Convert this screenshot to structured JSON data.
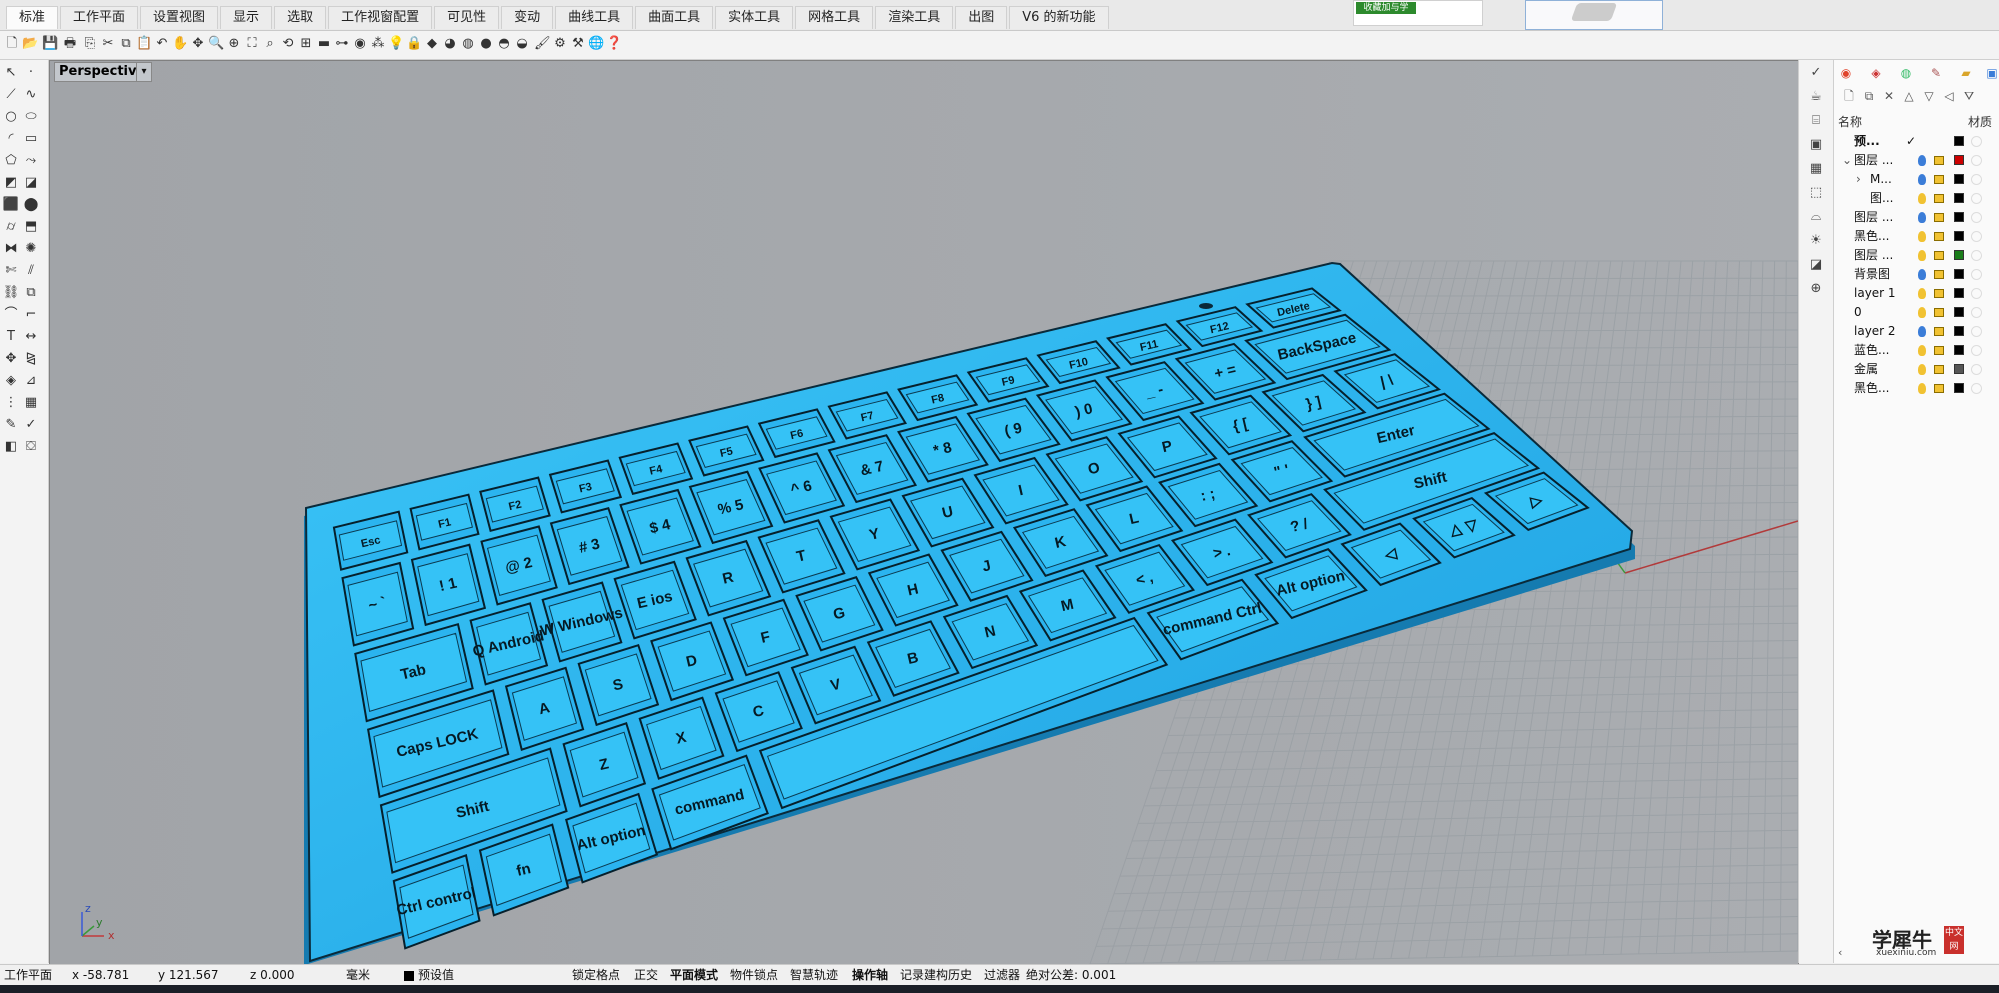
{
  "tabs": [
    {
      "label": "标准",
      "active": true
    },
    {
      "label": "工作平面"
    },
    {
      "label": "设置视图"
    },
    {
      "label": "显示"
    },
    {
      "label": "选取"
    },
    {
      "label": "工作视窗配置"
    },
    {
      "label": "可见性"
    },
    {
      "label": "变动"
    },
    {
      "label": "曲线工具"
    },
    {
      "label": "曲面工具"
    },
    {
      "label": "实体工具"
    },
    {
      "label": "网格工具"
    },
    {
      "label": "渲染工具"
    },
    {
      "label": "出图"
    },
    {
      "label": "V6 的新功能"
    }
  ],
  "ad_banner_text": "收藏加与学",
  "viewport": {
    "label": "Perspective",
    "menu_arrow": "▾",
    "axis_x": "x",
    "axis_y": "y",
    "axis_z": "z"
  },
  "keyboard": {
    "color": "#29b6f0",
    "rows": [
      {
        "keys": [
          "Esc",
          "F1",
          "F2",
          "F3",
          "F4",
          "F5",
          "F6",
          "F7",
          "F8",
          "F9",
          "F10",
          "F11",
          "F12",
          "Delete"
        ]
      },
      {
        "keys": [
          "~ `",
          "! 1",
          "@ 2",
          "# 3",
          "$ 4",
          "% 5",
          "^ 6",
          "& 7",
          "* 8",
          "( 9",
          ") 0",
          "_ -",
          "+ =",
          "BackSpace"
        ]
      },
      {
        "keys": [
          "Tab",
          "Q Android",
          "W Windows",
          "E ios",
          "R",
          "T",
          "Y",
          "U",
          "I",
          "O",
          "P",
          "{ [",
          "} ]",
          "| \\"
        ]
      },
      {
        "keys": [
          "Caps LOCK",
          "A",
          "S",
          "D",
          "F",
          "G",
          "H",
          "J",
          "K",
          "L",
          ": ;",
          "\" '",
          "Enter"
        ]
      },
      {
        "keys": [
          "Shift",
          "Z",
          "X",
          "C",
          "V",
          "B",
          "N",
          "M",
          "< ,",
          "> .",
          "? /",
          "Shift"
        ]
      },
      {
        "keys": [
          "Ctrl control",
          "fn",
          "Alt option",
          "command",
          "",
          "command Ctrl",
          "Alt option",
          "◁",
          "△ ▽",
          "▷"
        ]
      }
    ]
  },
  "layer_panel": {
    "tabs": [
      "color-icon",
      "layer-icon",
      "material-icon",
      "paint-icon",
      "folder-icon",
      "display-icon"
    ],
    "col_name": "名称",
    "col_material": "材质",
    "layers": [
      {
        "name": "预...",
        "indent": 0,
        "bold": true,
        "check": "✓",
        "color": "#000000",
        "expander": ""
      },
      {
        "name": "图层 ...",
        "indent": 0,
        "color": "#cc0000",
        "expander": "⌄",
        "bulb": "#3b7dd8"
      },
      {
        "name": "M...",
        "indent": 2,
        "color": "#000000",
        "expander": "›",
        "bulb": "#3b7dd8"
      },
      {
        "name": "图...",
        "indent": 2,
        "color": "#000000",
        "expander": "",
        "bulb": "#f1c232"
      },
      {
        "name": "图层 ...",
        "indent": 0,
        "color": "#000000",
        "expander": "",
        "bulb": "#3b7dd8"
      },
      {
        "name": "黑色...",
        "indent": 0,
        "color": "#000000",
        "expander": "",
        "bulb": "#f1c232"
      },
      {
        "name": "图层 ...",
        "indent": 0,
        "color": "#1a7d1a",
        "expander": "",
        "bulb": "#f1c232"
      },
      {
        "name": "背景图",
        "indent": 0,
        "color": "#000000",
        "expander": "",
        "bulb": "#3b7dd8"
      },
      {
        "name": "layer 1",
        "indent": 0,
        "color": "#000000",
        "expander": "",
        "bulb": "#f1c232"
      },
      {
        "name": "0",
        "indent": 0,
        "color": "#000000",
        "expander": "",
        "bulb": "#f1c232"
      },
      {
        "name": "layer 2",
        "indent": 0,
        "color": "#000000",
        "expander": "",
        "bulb": "#3b7dd8"
      },
      {
        "name": "蓝色...",
        "indent": 0,
        "color": "#000000",
        "expander": "",
        "bulb": "#f1c232"
      },
      {
        "name": "金属",
        "indent": 0,
        "color": "#555555",
        "expander": "",
        "bulb": "#f1c232"
      },
      {
        "name": "黑色...",
        "indent": 0,
        "color": "#000000",
        "expander": "",
        "bulb": "#f1c232"
      }
    ]
  },
  "logo": {
    "title": "学犀牛",
    "url": "xuexiniu.com",
    "badge": "中文网"
  },
  "status": {
    "cplane": "工作平面",
    "x": "x -58.781",
    "y": "y 121.567",
    "z": "z 0.000",
    "unit": "毫米",
    "default_layer": "预设值",
    "grid_snap": "锁定格点",
    "ortho": "正交",
    "planar": "平面模式",
    "osnap": "物件锁点",
    "smart_track": "智慧轨迹",
    "gumball": "操作轴",
    "history": "记录建构历史",
    "filter": "过滤器",
    "tolerance": "绝对公差: 0.001"
  }
}
